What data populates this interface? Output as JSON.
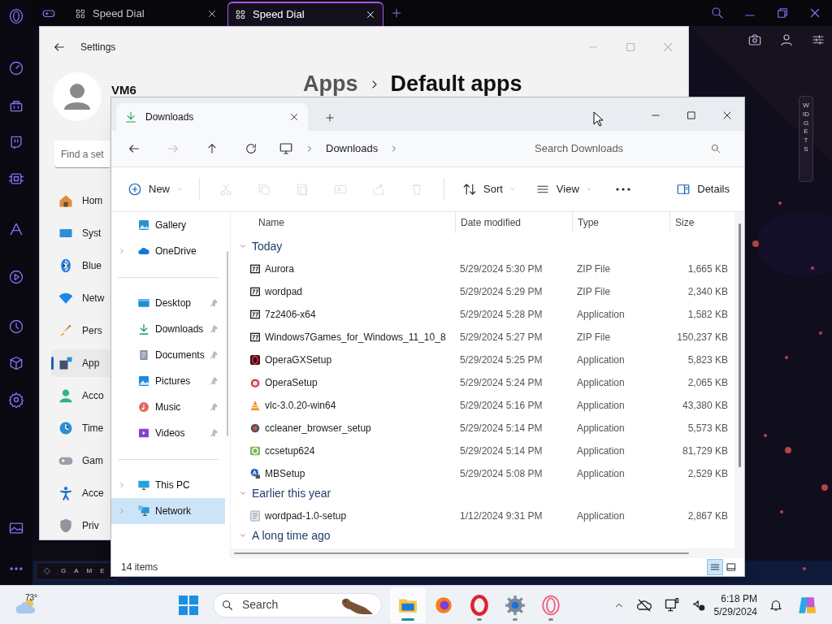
{
  "browser": {
    "tabs": [
      {
        "label": "Speed Dial",
        "selected": false
      },
      {
        "label": "Speed Dial",
        "selected": true
      }
    ],
    "widgets_label": "WIDGETS",
    "game_label": "GAME"
  },
  "settings": {
    "title": "Settings",
    "user": "VM6",
    "breadcrumb": [
      "Apps",
      "Default apps"
    ],
    "search_placeholder": "Find a set",
    "nav": [
      {
        "label": "Hom",
        "selected": false
      },
      {
        "label": "Syst",
        "selected": false
      },
      {
        "label": "Blue",
        "selected": false
      },
      {
        "label": "Netw",
        "selected": false
      },
      {
        "label": "Pers",
        "selected": false
      },
      {
        "label": "App",
        "selected": true
      },
      {
        "label": "Acco",
        "selected": false
      },
      {
        "label": "Time",
        "selected": false
      },
      {
        "label": "Gam",
        "selected": false
      },
      {
        "label": "Acce",
        "selected": false
      },
      {
        "label": "Priv",
        "selected": false
      }
    ]
  },
  "explorer": {
    "tab": "Downloads",
    "address": [
      "Downloads"
    ],
    "search_placeholder": "Search Downloads",
    "nav_buttons": [
      {
        "disabled": false
      },
      {
        "disabled": true
      },
      {
        "disabled": false
      },
      {
        "disabled": false
      }
    ],
    "commands": [
      {
        "kind": "menu",
        "label": "New",
        "disabled": false
      },
      {
        "kind": "icon",
        "disabled": true
      },
      {
        "kind": "icon",
        "disabled": true
      },
      {
        "kind": "icon",
        "disabled": true
      },
      {
        "kind": "icon",
        "disabled": true
      },
      {
        "kind": "icon",
        "disabled": true
      },
      {
        "kind": "icon",
        "disabled": true
      },
      {
        "kind": "menu",
        "label": "Sort",
        "disabled": false
      },
      {
        "kind": "menu",
        "label": "View",
        "disabled": false
      },
      {
        "kind": "more",
        "disabled": false
      }
    ],
    "details_label": "Details",
    "nav_sections": [
      [
        {
          "label": "Gallery",
          "collapsed": false,
          "pinned": false,
          "selected": false
        },
        {
          "label": "OneDrive",
          "collapsed": true,
          "pinned": false,
          "selected": false
        }
      ],
      [
        {
          "label": "Desktop",
          "collapsed": false,
          "pinned": true,
          "selected": false
        },
        {
          "label": "Downloads",
          "collapsed": false,
          "pinned": true,
          "selected": false
        },
        {
          "label": "Documents",
          "collapsed": false,
          "pinned": true,
          "selected": false
        },
        {
          "label": "Pictures",
          "collapsed": false,
          "pinned": true,
          "selected": false
        },
        {
          "label": "Music",
          "collapsed": false,
          "pinned": true,
          "selected": false
        },
        {
          "label": "Videos",
          "collapsed": false,
          "pinned": true,
          "selected": false
        }
      ],
      [
        {
          "label": "This PC",
          "collapsed": true,
          "pinned": false,
          "selected": false
        },
        {
          "label": "Network",
          "collapsed": true,
          "pinned": false,
          "selected": true
        }
      ]
    ],
    "columns": [
      "Name",
      "Date modified",
      "Type",
      "Size"
    ],
    "groups": [
      {
        "label": "Today",
        "expanded": true,
        "files": [
          {
            "kind": "archive",
            "name": "Aurora",
            "date": "5/29/2024 5:30 PM",
            "type": "ZIP File",
            "size": "1,665 KB"
          },
          {
            "kind": "archive",
            "name": "wordpad",
            "date": "5/29/2024 5:29 PM",
            "type": "ZIP File",
            "size": "2,340 KB"
          },
          {
            "kind": "archive",
            "name": "7z2406-x64",
            "date": "5/29/2024 5:28 PM",
            "type": "Application",
            "size": "1,582 KB"
          },
          {
            "kind": "archive",
            "name": "Windows7Games_for_Windows_11_10_8",
            "date": "5/29/2024 5:27 PM",
            "type": "ZIP File",
            "size": "150,237 KB"
          },
          {
            "kind": "gx",
            "name": "OperaGXSetup",
            "date": "5/29/2024 5:25 PM",
            "type": "Application",
            "size": "5,823 KB"
          },
          {
            "kind": "opera",
            "name": "OperaSetup",
            "date": "5/29/2024 5:24 PM",
            "type": "Application",
            "size": "2,065 KB"
          },
          {
            "kind": "cone",
            "name": "vlc-3.0.20-win64",
            "date": "5/29/2024 5:16 PM",
            "type": "Application",
            "size": "43,380 KB"
          },
          {
            "kind": "ccbrowser",
            "name": "ccleaner_browser_setup",
            "date": "5/29/2024 5:14 PM",
            "type": "Application",
            "size": "5,573 KB"
          },
          {
            "kind": "cc",
            "name": "ccsetup624",
            "date": "5/29/2024 5:14 PM",
            "type": "Application",
            "size": "81,729 KB"
          },
          {
            "kind": "mb",
            "name": "MBSetup",
            "date": "5/29/2024 5:08 PM",
            "type": "Application",
            "size": "2,529 KB"
          }
        ]
      },
      {
        "label": "Earlier this year",
        "expanded": true,
        "files": [
          {
            "kind": "setup",
            "name": "wordpad-1.0-setup",
            "date": "1/12/2024 9:31 PM",
            "type": "Application",
            "size": "2,867 KB"
          }
        ]
      },
      {
        "label": "A long time ago",
        "expanded": true
      }
    ],
    "status": "14 items",
    "views": [
      {
        "selected": true
      },
      {
        "selected": false
      }
    ]
  },
  "taskbar": {
    "temperature": "73°",
    "search_placeholder": "Search",
    "apps": [
      {
        "active": true,
        "running": true
      },
      {
        "active": false,
        "running": false
      },
      {
        "active": false,
        "running": true
      },
      {
        "active": false,
        "running": true
      },
      {
        "active": false,
        "running": true
      }
    ],
    "time": "6:18 PM",
    "date": "5/29/2024"
  }
}
